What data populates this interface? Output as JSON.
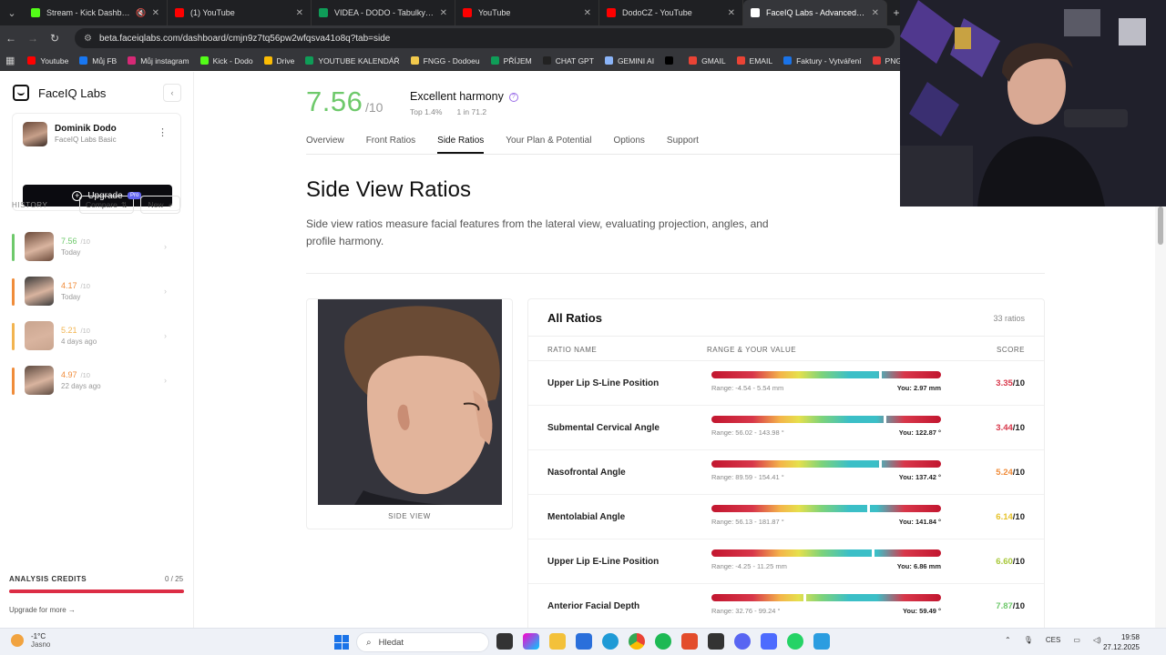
{
  "browser": {
    "tabs": [
      {
        "label": "Stream - Kick Dashboard",
        "color": "#53fc18",
        "muted": true
      },
      {
        "label": "(1) YouTube",
        "color": "#ff0000"
      },
      {
        "label": "VIDEA - DODO - Tabulky Goog",
        "color": "#0f9d58"
      },
      {
        "label": "YouTube",
        "color": "#ff0000"
      },
      {
        "label": "DodoCZ - YouTube",
        "color": "#ff0000"
      },
      {
        "label": "FaceIQ Labs - Advanced Facial A",
        "color": "#ffffff",
        "active": true
      }
    ],
    "url": "beta.faceiqlabs.com/dashboard/cmjn9z7tq56pw2wfqsva41o8q?tab=side",
    "bookmarks": [
      {
        "label": "Youtube",
        "color": "#ff0000"
      },
      {
        "label": "Můj FB",
        "color": "#1877f2"
      },
      {
        "label": "Můj instagram",
        "color": "#d62976"
      },
      {
        "label": "Kick - Dodo",
        "color": "#53fc18"
      },
      {
        "label": "Drive",
        "color": "#fbbc04"
      },
      {
        "label": "YOUTUBE KALENDÁŘ",
        "color": "#0f9d58"
      },
      {
        "label": "FNGG - Dodoeu",
        "color": "#f2c94c"
      },
      {
        "label": "PŘÍJEM",
        "color": "#0f9d58"
      },
      {
        "label": "CHAT GPT",
        "color": "#222222"
      },
      {
        "label": "GEMINI AI",
        "color": "#8ab4f8"
      },
      {
        "label": "",
        "color": "#000000"
      },
      {
        "label": "GMAIL",
        "color": "#ea4335"
      },
      {
        "label": "EMAIL",
        "color": "#ea4335"
      },
      {
        "label": "Faktury - Vytváření",
        "color": "#1a73e8"
      },
      {
        "label": "PNG to PDF",
        "color": "#e53935"
      },
      {
        "label": "ht",
        "color": "#ffffff"
      }
    ]
  },
  "sidebar": {
    "brand": "FaceIQ Labs",
    "profile": {
      "name": "Dominik Dodo",
      "plan": "FaceIQ Labs Basic"
    },
    "upgrade_label": "Upgrade",
    "history_label": "HISTORY",
    "compare_label": "Compare",
    "pro_badge": "Pro",
    "new_label": "New",
    "history": [
      {
        "score": "7.56",
        "den": "/10",
        "date": "Today",
        "color": "#6ec96b",
        "thumb": "#6b4a3a"
      },
      {
        "score": "4.17",
        "den": "/10",
        "date": "Today",
        "color": "#f08c3a",
        "thumb": "#3a3a3a"
      },
      {
        "score": "5.21",
        "den": "/10",
        "date": "4 days ago",
        "color": "#f2b450",
        "thumb": "#c9a58f"
      },
      {
        "score": "4.97",
        "den": "/10",
        "date": "22 days ago",
        "color": "#f08c3a",
        "thumb": "#5d4a40"
      }
    ],
    "credits_label": "ANALYSIS CREDITS",
    "credits_count": "0 / 25",
    "credits_fill_pct": 100,
    "upgrade_more": "Upgrade for more →"
  },
  "header": {
    "score": "7.56",
    "score_den": "/10",
    "harmony": "Excellent harmony",
    "top": "Top 1.4%",
    "one_in": "1 in 71.2",
    "tabs": [
      "Overview",
      "Front Ratios",
      "Side Ratios",
      "Your Plan & Potential",
      "Options",
      "Support"
    ],
    "active_tab": 2
  },
  "section": {
    "title": "Side View Ratios",
    "description": "Side view ratios measure facial features from the lateral view, evaluating projection, angles, and profile harmony."
  },
  "photo": {
    "caption": "SIDE VIEW"
  },
  "ratios": {
    "title": "All Ratios",
    "count": "33 ratios",
    "headers": {
      "name": "RATIO NAME",
      "range": "RANGE & YOUR VALUE",
      "score": "SCORE"
    },
    "rows": [
      {
        "name": "Upper Lip S-Line Position",
        "range": "Range: -4.54 - 5.54 mm",
        "you": "You: 2.97 mm",
        "score": "3.35",
        "den": "/10",
        "marker": 73,
        "color": "#d8374a"
      },
      {
        "name": "Submental Cervical Angle",
        "range": "Range: 56.02 - 143.98 °",
        "you": "You: 122.87 °",
        "score": "3.44",
        "den": "/10",
        "marker": 75,
        "color": "#d8374a"
      },
      {
        "name": "Nasofrontal Angle",
        "range": "Range: 89.59 - 154.41 °",
        "you": "You: 137.42 °",
        "score": "5.24",
        "den": "/10",
        "marker": 73,
        "color": "#f08c3a"
      },
      {
        "name": "Mentolabial Angle",
        "range": "Range: 56.13 - 181.87 °",
        "you": "You: 141.84 °",
        "score": "6.14",
        "den": "/10",
        "marker": 68,
        "color": "#e6c229"
      },
      {
        "name": "Upper Lip E-Line Position",
        "range": "Range: -4.25 - 11.25 mm",
        "you": "You: 6.86 mm",
        "score": "6.60",
        "den": "/10",
        "marker": 70,
        "color": "#a8c83a"
      },
      {
        "name": "Anterior Facial Depth",
        "range": "Range: 32.76 - 99.24 °",
        "you": "You: 59.49 °",
        "score": "7.87",
        "den": "/10",
        "marker": 40,
        "color": "#6ec96b"
      }
    ]
  },
  "taskbar": {
    "temp": "-1°C",
    "weather": "Jasno",
    "search": "Hledat",
    "lang": "CES",
    "time": "19:58",
    "date": "27.12.2025"
  }
}
